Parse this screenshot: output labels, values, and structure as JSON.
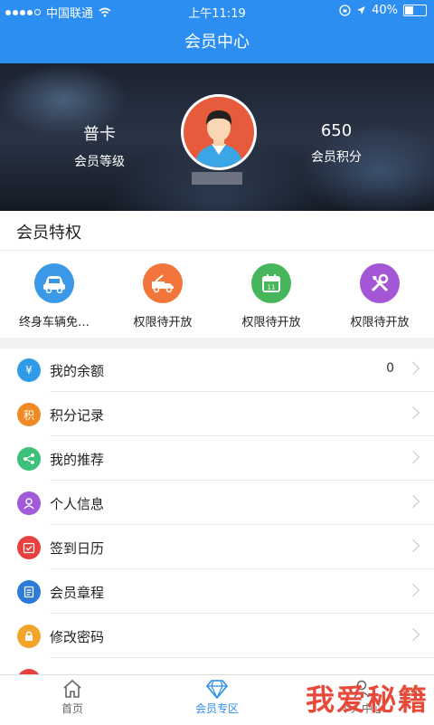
{
  "status_bar": {
    "carrier": "中国联通",
    "time": "上午11:19",
    "battery": "40%",
    "battery_level": 0.4
  },
  "nav": {
    "title": "会员中心"
  },
  "profile": {
    "level_value": "普卡",
    "level_label": "会员等级",
    "points_value": "650",
    "points_label": "会员积分"
  },
  "privileges": {
    "title": "会员特权",
    "items": [
      {
        "label": "终身车辆免…",
        "icon": "car-icon",
        "color": "#3b98e6"
      },
      {
        "label": "权限待开放",
        "icon": "tow-truck-icon",
        "color": "#f2763b"
      },
      {
        "label": "权限待开放",
        "icon": "calendar-icon",
        "color": "#47b55a"
      },
      {
        "label": "权限待开放",
        "icon": "tools-icon",
        "color": "#a357d6"
      }
    ]
  },
  "menu": [
    {
      "label": "我的余额",
      "value": "0",
      "icon": "yen-icon",
      "glyph": "¥",
      "color": "#2f9be8"
    },
    {
      "label": "积分记录",
      "icon": "points-icon",
      "glyph": "积",
      "color": "#f08a25"
    },
    {
      "label": "我的推荐",
      "icon": "share-icon",
      "glyph": "",
      "color": "#3cc07a"
    },
    {
      "label": "个人信息",
      "icon": "person-icon",
      "glyph": "",
      "color": "#a35ad8"
    },
    {
      "label": "签到日历",
      "icon": "checkin-calendar-icon",
      "glyph": "",
      "color": "#ea3f3f"
    },
    {
      "label": "会员章程",
      "icon": "document-icon",
      "glyph": "",
      "color": "#2d7bd6"
    },
    {
      "label": "修改密码",
      "icon": "lock-icon",
      "glyph": "",
      "color": "#f3a42a"
    },
    {
      "label": "",
      "icon": "partial-row-icon",
      "glyph": "",
      "color": "#e64040"
    }
  ],
  "tabs": [
    {
      "label": "首页",
      "icon": "home-icon"
    },
    {
      "label": "会员专区",
      "icon": "diamond-icon"
    },
    {
      "label": "个人中心",
      "icon": "user-icon"
    }
  ],
  "watermark": "我爱秘籍",
  "colors": {
    "primary": "#2b8ef0",
    "watermark": "#e84a3a"
  }
}
